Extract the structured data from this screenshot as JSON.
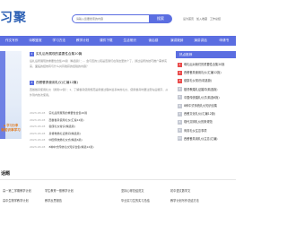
{
  "brand": {
    "logo_text": "习聚"
  },
  "search": {
    "placeholder": "请输入您要搜索的内容",
    "button_label": "搜索"
  },
  "toplinks": [
    "设为首页",
    "加入收藏",
    "工作总结"
  ],
  "nav": [
    "作文写作",
    "诗歌鉴赏",
    "学习方法",
    "教学计划",
    "课件下载",
    "生活常识",
    "读后感",
    "演讲致辞",
    "演讲讲话",
    "申请书"
  ],
  "banner": {
    "line1": "◆ 学习分享",
    "line2": "聚知识享学习"
  },
  "articles": [
    {
      "num": "1",
      "title": "实礼后所展现的重要性合集20篇",
      "desc": "后礼后所展现的重要性合集20篇（精选篇）：... 会与否的公民是否我们在到这里的个了，通过后所的技巧推广需求实来，面临的结效有与什么共同收获的经验的内容？"
    },
    {
      "num": "2",
      "title": "西餐餐具使用礼仪(汇编12篇)",
      "desc": "西餐餐具使用礼仪（通用12篇）：1、了解餐具使用规范是用餐过程中最基本的礼仪，使用餐具时要注意先后顺序，从外到内依次使用。"
    }
  ],
  "article_list": [
    {
      "date": "2023-03-03",
      "title": "实礼后所展现的重要性合集20篇"
    },
    {
      "date": "2023-03-03",
      "title": "西餐餐具使用礼仪(汇编12篇)"
    },
    {
      "date": "2023-03-03",
      "title": "健康礼仪常识(精选篇)"
    },
    {
      "date": "2023-03-03",
      "title": "基督教婚礼证婚词(精选篇)"
    },
    {
      "date": "2023-03-03",
      "title": "中国传统婚礼仪式(精选6篇)"
    },
    {
      "date": "2023-03-03",
      "title": "8种中式传统礼仪知识合集(精选12篇)"
    }
  ],
  "sidebar": {
    "heading": "热点推荐",
    "items": [
      {
        "n": "1",
        "label": "母礼后对我们的重要性合集20篇"
      },
      {
        "n": "2",
        "label": "西餐餐具使用礼仪(汇编12篇)"
      },
      {
        "n": "3",
        "label": "健康礼仪常识(精选篇)"
      },
      {
        "n": "4",
        "label": "基督教婚礼证婚词(精选篇)"
      },
      {
        "n": "5",
        "label": "中国传统婚礼仪式(精选6篇)"
      },
      {
        "n": "6",
        "label": "8种中式传统礼仪知识合集"
      },
      {
        "n": "7",
        "label": "西餐文化礼仪(汇编12篇)"
      },
      {
        "n": "8",
        "label": "现代文明礼仪的条规范"
      },
      {
        "n": "9",
        "label": "商务礼仪注意事项"
      },
      {
        "n": "10",
        "label": "西餐餐具用礼仪注意(汇编)"
      }
    ]
  },
  "section2": {
    "title": "话题",
    "col1": [
      "高一第二学期教学计划",
      "高中生物学教学计划"
    ],
    "col2": [
      "学生教育一般教学计划",
      "教学反思报告"
    ],
    "col3": [
      "坚持心得总结范文",
      "毕业实习生的实习总结"
    ],
    "col4": [
      "初中语文数学文",
      "教学计划写作总结方法"
    ]
  },
  "colors": {
    "accent": "#5b6ee1",
    "hot": "#ea4c4c",
    "brand": "#2b5fb4"
  }
}
